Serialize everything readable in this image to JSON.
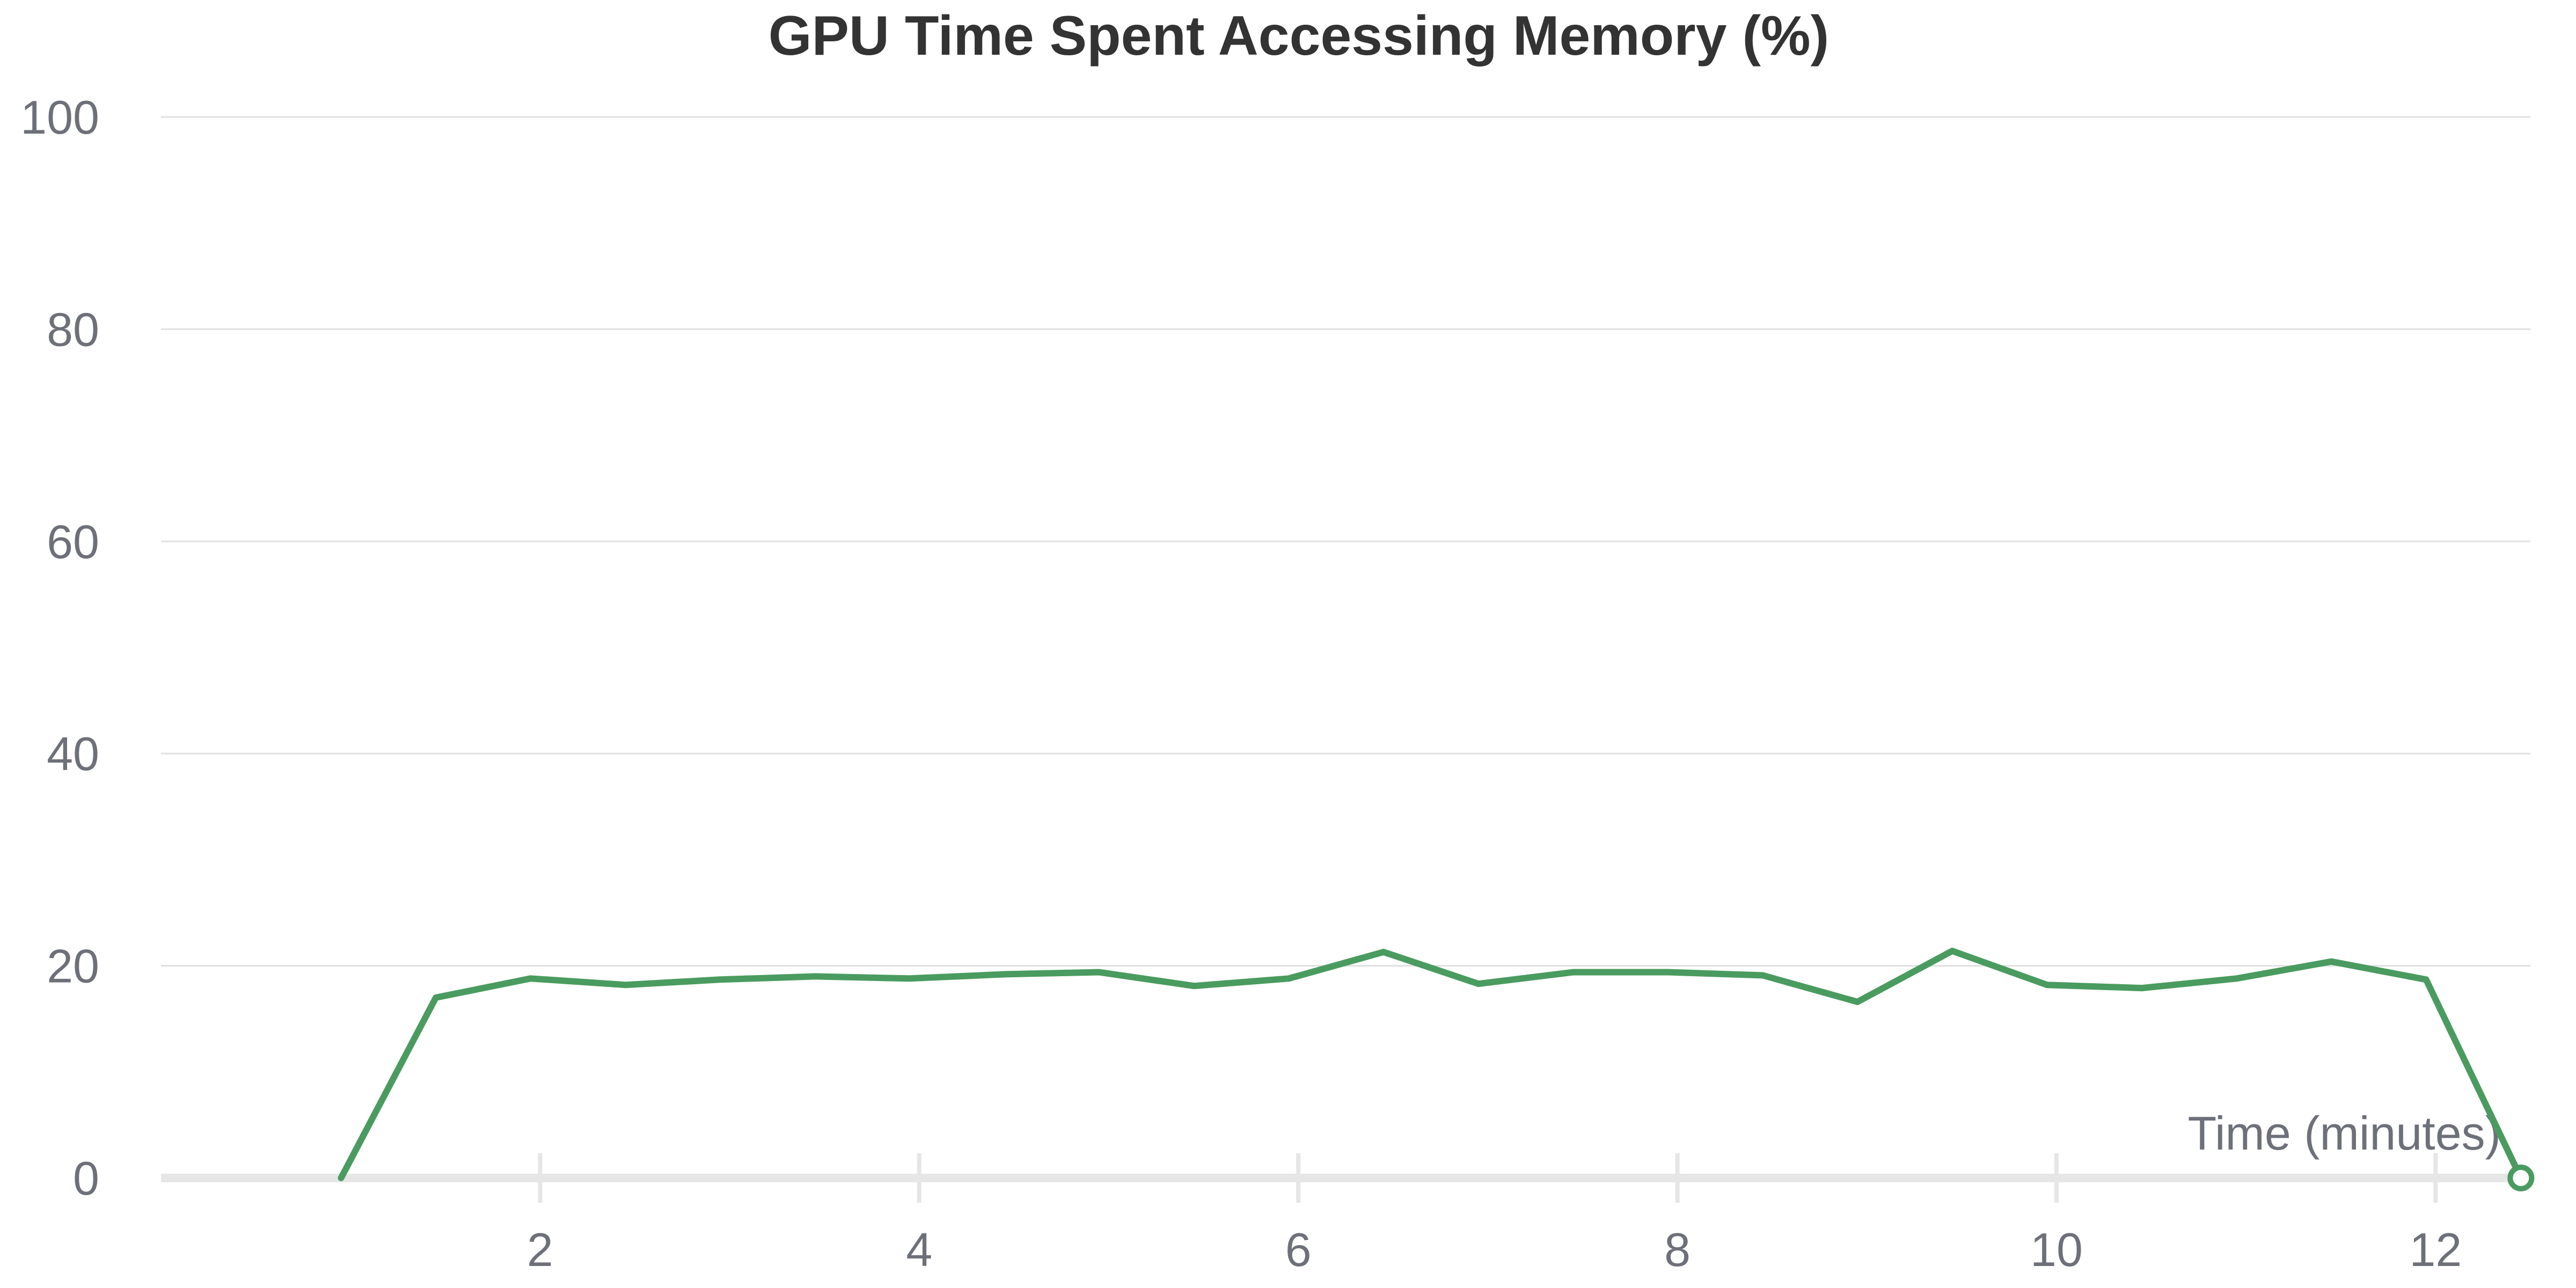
{
  "chart_data": {
    "type": "line",
    "title": "GPU Time Spent Accessing Memory (%)",
    "xlabel": "Time (minutes)",
    "ylabel": "",
    "xlim": [
      0,
      12.5
    ],
    "ylim": [
      0,
      100
    ],
    "x_ticks": [
      "2",
      "4",
      "6",
      "8",
      "10",
      "12"
    ],
    "x_tick_values": [
      2,
      4,
      6,
      8,
      10,
      12
    ],
    "y_ticks": [
      "0",
      "20",
      "40",
      "60",
      "80",
      "100"
    ],
    "y_tick_values": [
      0,
      20,
      40,
      60,
      80,
      100
    ],
    "grid": true,
    "legend": "none",
    "series": [
      {
        "color": "#4a9b5f",
        "x": [
          0.95,
          1.45,
          1.95,
          2.45,
          2.95,
          3.45,
          3.95,
          4.45,
          4.95,
          5.45,
          5.95,
          6.45,
          6.95,
          7.45,
          7.95,
          8.45,
          8.95,
          9.45,
          9.95,
          10.45,
          10.95,
          11.45,
          11.95,
          12.45
        ],
        "y": [
          0,
          17.0,
          18.8,
          18.2,
          18.7,
          19.0,
          18.8,
          19.2,
          19.4,
          18.1,
          18.8,
          21.3,
          18.3,
          19.4,
          19.4,
          19.1,
          16.6,
          21.4,
          18.2,
          17.9,
          18.8,
          20.4,
          18.7,
          0
        ]
      }
    ]
  },
  "colors": {
    "series": "#4a9b5f",
    "grid": "#e0e0e0",
    "axis": "#e6e6e6",
    "label": "#6e7079",
    "title": "#333333"
  }
}
